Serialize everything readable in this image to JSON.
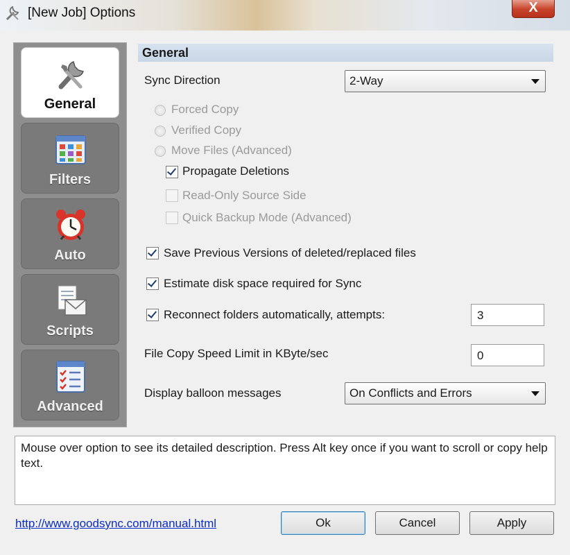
{
  "window": {
    "title": "[New Job] Options",
    "close_label": "X"
  },
  "sidebar": {
    "items": [
      {
        "label": "General",
        "icon": "wrench-screwdriver-icon",
        "active": true
      },
      {
        "label": "Filters",
        "icon": "filter-grid-icon",
        "active": false
      },
      {
        "label": "Auto",
        "icon": "alarm-clock-icon",
        "active": false
      },
      {
        "label": "Scripts",
        "icon": "script-envelope-icon",
        "active": false
      },
      {
        "label": "Advanced",
        "icon": "checklist-icon",
        "active": false
      }
    ]
  },
  "section": {
    "title": "General"
  },
  "form": {
    "sync_direction_label": "Sync Direction",
    "sync_direction_value": "2-Way",
    "radios": [
      "Forced Copy",
      "Verified Copy",
      "Move Files (Advanced)"
    ],
    "propagate_deletions": "Propagate Deletions",
    "read_only_source": "Read-Only Source Side",
    "quick_backup": "Quick Backup Mode (Advanced)",
    "save_previous": "Save Previous Versions of deleted/replaced files",
    "estimate_disk": "Estimate disk space required for Sync",
    "reconnect": "Reconnect folders automatically, attempts:",
    "reconnect_attempts": "3",
    "speed_limit_label": "File Copy Speed Limit in KByte/sec",
    "speed_limit_value": "0",
    "balloon_label": "Display balloon messages",
    "balloon_value": "On Conflicts and Errors"
  },
  "help": {
    "text": "Mouse over option to see its detailed description. Press Alt key once if you want to scroll or copy help text."
  },
  "footer": {
    "link": "http://www.goodsync.com/manual.html",
    "ok": "Ok",
    "cancel": "Cancel",
    "apply": "Apply"
  },
  "colors": {
    "header": "#c8d6e6",
    "sidebar": "#8e8e8e",
    "link": "#0b2cc4"
  }
}
